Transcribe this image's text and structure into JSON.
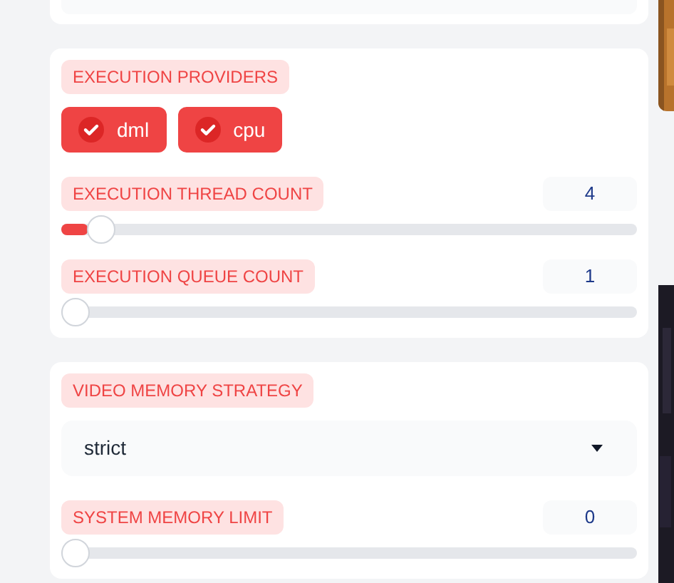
{
  "execution": {
    "providers_label": "EXECUTION PROVIDERS",
    "providers": [
      {
        "label": "dml",
        "checked": true
      },
      {
        "label": "cpu",
        "checked": true
      }
    ],
    "sliders": [
      {
        "label": "EXECUTION THREAD COUNT",
        "value": "4",
        "level": 0.047
      },
      {
        "label": "EXECUTION QUEUE COUNT",
        "value": "1",
        "level": 0
      }
    ]
  },
  "memory": {
    "strategy_label": "VIDEO MEMORY STRATEGY",
    "strategy": "strict",
    "sliders": [
      {
        "label": "SYSTEM MEMORY LIMIT",
        "value": "0",
        "level": 0
      }
    ]
  }
}
